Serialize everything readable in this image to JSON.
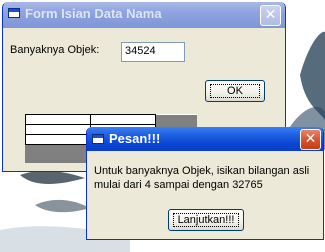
{
  "main_window": {
    "title": "Form Isian Data Nama",
    "close_symbol": "✕",
    "count_label": "Banyaknya Objek:",
    "count_value": "34524",
    "ok_label": "OK"
  },
  "dialog": {
    "title": "Pesan!!!",
    "close_symbol": "✕",
    "message_line1": "Untuk banyaknya Objek, isikan bilangan asli",
    "message_line2": "mulai dari 4 sampai dengan 32765",
    "continue_label": "Lanjutkan!!!"
  },
  "colors": {
    "titlebar_active": "#0a46d6",
    "titlebar_inactive": "#8ea3df",
    "window_face": "#ece9d8",
    "close_button": "#d9552f"
  },
  "icons": [
    "app-icon",
    "close-icon"
  ]
}
